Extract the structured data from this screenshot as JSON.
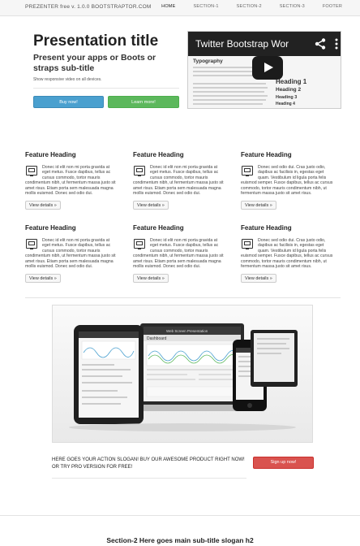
{
  "navbar": {
    "brand": "PREZENTER free v. 1.0.0 BOOTSTRAPTOR.COM",
    "links": [
      "HOME",
      "SECTION-1",
      "SECTION-2",
      "SECTION-3",
      "FOOTER"
    ]
  },
  "hero": {
    "title": "Presentation title",
    "subtitle": "Present your apps or Boots or straps sub-title",
    "note": "Show responsive video on all devices.",
    "buy_label": "Buy now!",
    "learn_label": "Learn more!"
  },
  "video": {
    "title": "Twitter Bootstrap Wor",
    "typography": "Typography",
    "heading1": "Heading 1",
    "heading2": "Heading 2",
    "heading3": "Heading 3",
    "heading4": "Heading 4",
    "icons": [
      "share-icon",
      "more-icon",
      "play-icon"
    ]
  },
  "features": [
    {
      "title": "Feature Heading",
      "body": "Donec id elit non mi porta gravida at eget metus. Fusce dapibus, tellus ac cursus commodo, tortor mauris condimentum nibh, ut fermentum massa justo sit amet risus. Etiam porta sem malesuada magna mollis euismod. Donec sed odio dui.",
      "button": "View details »"
    },
    {
      "title": "Feature Heading",
      "body": "Donec id elit non mi porta gravida at eget metus. Fusce dapibus, tellus ac cursus commodo, tortor mauris condimentum nibh, ut fermentum massa justo sit amet risus. Etiam porta sem malesuada magna mollis euismod. Donec sed odio dui.",
      "button": "View details »"
    },
    {
      "title": "Feature Heading",
      "body": "Donec sed odio dui. Cras justo odio, dapibus ac facilisis in, egestas eget quam. Vestibulum id ligula porta felis euismod semper. Fusce dapibus, tellus ac cursus commodo, tortor mauris condimentum nibh, ut fermentum massa justo sit amet risus.",
      "button": "View details »"
    },
    {
      "title": "Feature Heading",
      "body": "Donec id elit non mi porta gravida at eget metus. Fusce dapibus, tellus ac cursus commodo, tortor mauris condimentum nibh, ut fermentum massa justo sit amet risus. Etiam porta sem malesuada magna mollis euismod. Donec sed odio dui.",
      "button": "View details »"
    },
    {
      "title": "Feature Heading",
      "body": "Donec id elit non mi porta gravida at eget metus. Fusce dapibus, tellus ac cursus commodo, tortor mauris condimentum nibh, ut fermentum massa justo sit amet risus. Etiam porta sem malesuada magna mollis euismod. Donec sed odio dui.",
      "button": "View details »"
    },
    {
      "title": "Feature Heading",
      "body": "Donec sed odio dui. Cras justo odio, dapibus ac facilisis in, egestas eget quam. Vestibulum id ligula porta felis euismod semper. Fusce dapibus, tellus ac cursus commodo, tortor mauris condimentum nibh, ut fermentum massa justo sit amet risus.",
      "button": "View details »"
    }
  ],
  "showcase": {
    "window_title": "Web Screen Presentation",
    "app_title": "Dashboard"
  },
  "action": {
    "slogan": "HERE GOES YOUR ACTION SLOGAN! BUY OUR AWESOME PRODUCT RIGHT NOW! OR TRY PRO VERSION FOR FREE!",
    "signup_label": "Sign up now!"
  },
  "section2": {
    "title": "Section-2 Here goes main sub-title slogan h2"
  }
}
